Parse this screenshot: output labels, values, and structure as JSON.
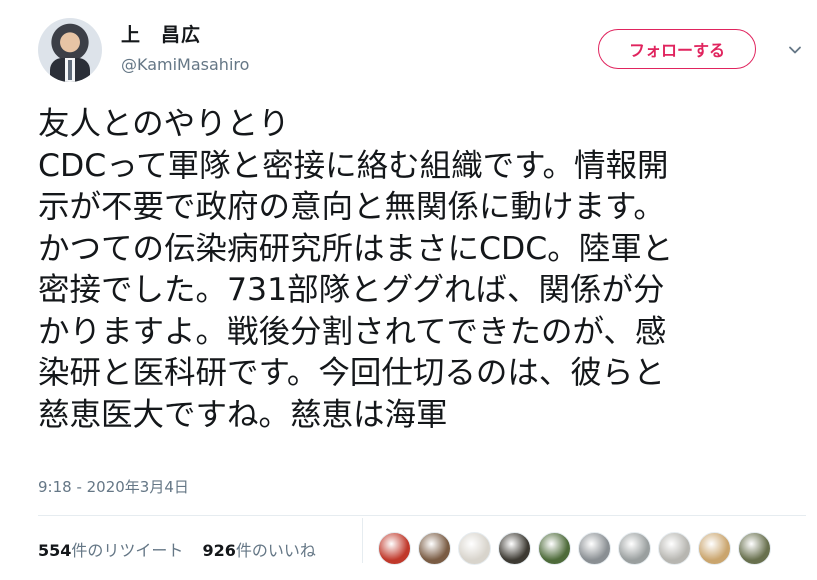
{
  "user": {
    "name": "上　昌広",
    "handle": "@KamiMasahiro"
  },
  "follow_button": {
    "label": "フォローする",
    "color": "#e0245e"
  },
  "tweet": {
    "lines": [
      "友人とのやりとり",
      "CDCって軍隊と密接に絡む組織です。情報開",
      "示が不要で政府の意向と無関係に動けます。",
      "かつての伝染病研究所はまさにCDC。陸軍と",
      "密接でした。731部隊とググれば、関係が分",
      "かりますよ。戦後分割されてできたのが、感",
      "染研と医科研です。今回仕切るのは、彼らと",
      "慈恵医大ですね。慈恵は海軍"
    ],
    "timestamp": "9:18 - 2020年3月4日"
  },
  "stats": {
    "retweets_count": "554",
    "retweets_label": "件のリツイート",
    "likes_count": "926",
    "likes_label": "件のいいね"
  },
  "likers": [
    {
      "icon": "avatar-red-costume-icon",
      "color": "#c0392b"
    },
    {
      "icon": "avatar-figurine-icon",
      "color": "#7a5c44"
    },
    {
      "icon": "avatar-white-bird-icon",
      "color": "#d8d4cc"
    },
    {
      "icon": "avatar-dark-photo-icon",
      "color": "#3d3a33"
    },
    {
      "icon": "avatar-tree-icon",
      "color": "#4e6b3a"
    },
    {
      "icon": "avatar-cat-icon",
      "color": "#8a8f93"
    },
    {
      "icon": "avatar-cat-grey-icon",
      "color": "#9a9f9f"
    },
    {
      "icon": "avatar-cat-white-icon",
      "color": "#b7b6b1"
    },
    {
      "icon": "avatar-dog-icon",
      "color": "#caa56e"
    },
    {
      "icon": "avatar-plant-icon",
      "color": "#68704e"
    }
  ]
}
